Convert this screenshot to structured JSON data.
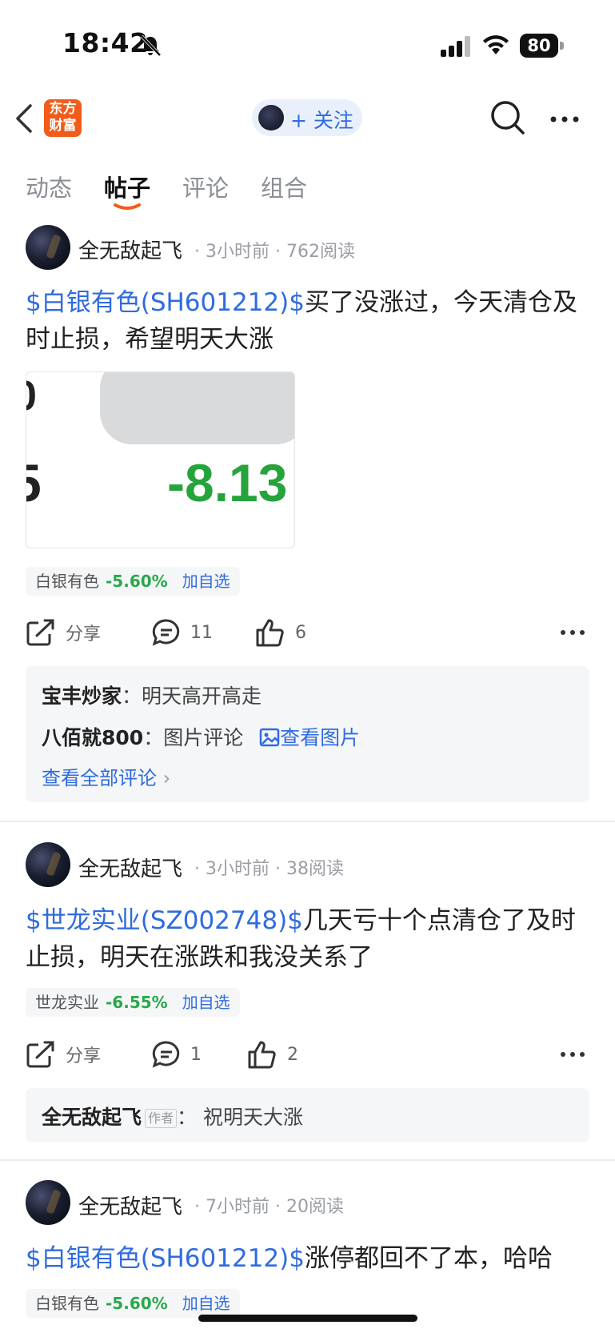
{
  "status_bar": {
    "time": "18:42",
    "battery": "80"
  },
  "nav": {
    "logo_text_line1": "东方",
    "logo_text_line2": "财富",
    "follow_label": "+ 关注"
  },
  "tabs": [
    {
      "label": "动态"
    },
    {
      "label": "帖子"
    },
    {
      "label": "评论"
    },
    {
      "label": "组合"
    }
  ],
  "posts": [
    {
      "author": "全无敌起飞",
      "time": "3小时前",
      "reads": "762阅读",
      "stock_link": "$白银有色(SH601212)$",
      "text": "买了没涨过，今天清仓及时止损，希望明天大涨",
      "image_text": "-8.13",
      "image_frag_top": "0",
      "image_frag": "5",
      "quote": {
        "name": "白银有色",
        "change": "-5.60%",
        "add": "加自选"
      },
      "actions": {
        "share": "分享",
        "comments": "11",
        "likes": "6"
      },
      "comments": [
        {
          "name": "宝丰炒家",
          "text": "明天高开高走"
        },
        {
          "name": "八佰就800",
          "text": "图片评论",
          "link": "查看图片"
        }
      ],
      "view_all": "查看全部评论"
    },
    {
      "author": "全无敌起飞",
      "time": "3小时前",
      "reads": "38阅读",
      "stock_link": "$世龙实业(SZ002748)$",
      "text": "几天亏十个点清仓了及时止损，明天在涨跌和我没关系了",
      "quote": {
        "name": "世龙实业",
        "change": "-6.55%",
        "add": "加自选"
      },
      "actions": {
        "share": "分享",
        "comments": "1",
        "likes": "2"
      },
      "comments": [
        {
          "name": "全无敌起飞",
          "tag": "作者",
          "text": "祝明天大涨"
        }
      ]
    },
    {
      "author": "全无敌起飞",
      "time": "7小时前",
      "reads": "20阅读",
      "stock_link": "$白银有色(SH601212)$",
      "text": "涨停都回不了本，哈哈",
      "quote": {
        "name": "白银有色",
        "change": "-5.60%",
        "add": "加自选"
      }
    }
  ],
  "colors": {
    "accent_blue": "#2f6be0",
    "down_green": "#2aa84a",
    "brand_orange": "#f25c1a"
  }
}
